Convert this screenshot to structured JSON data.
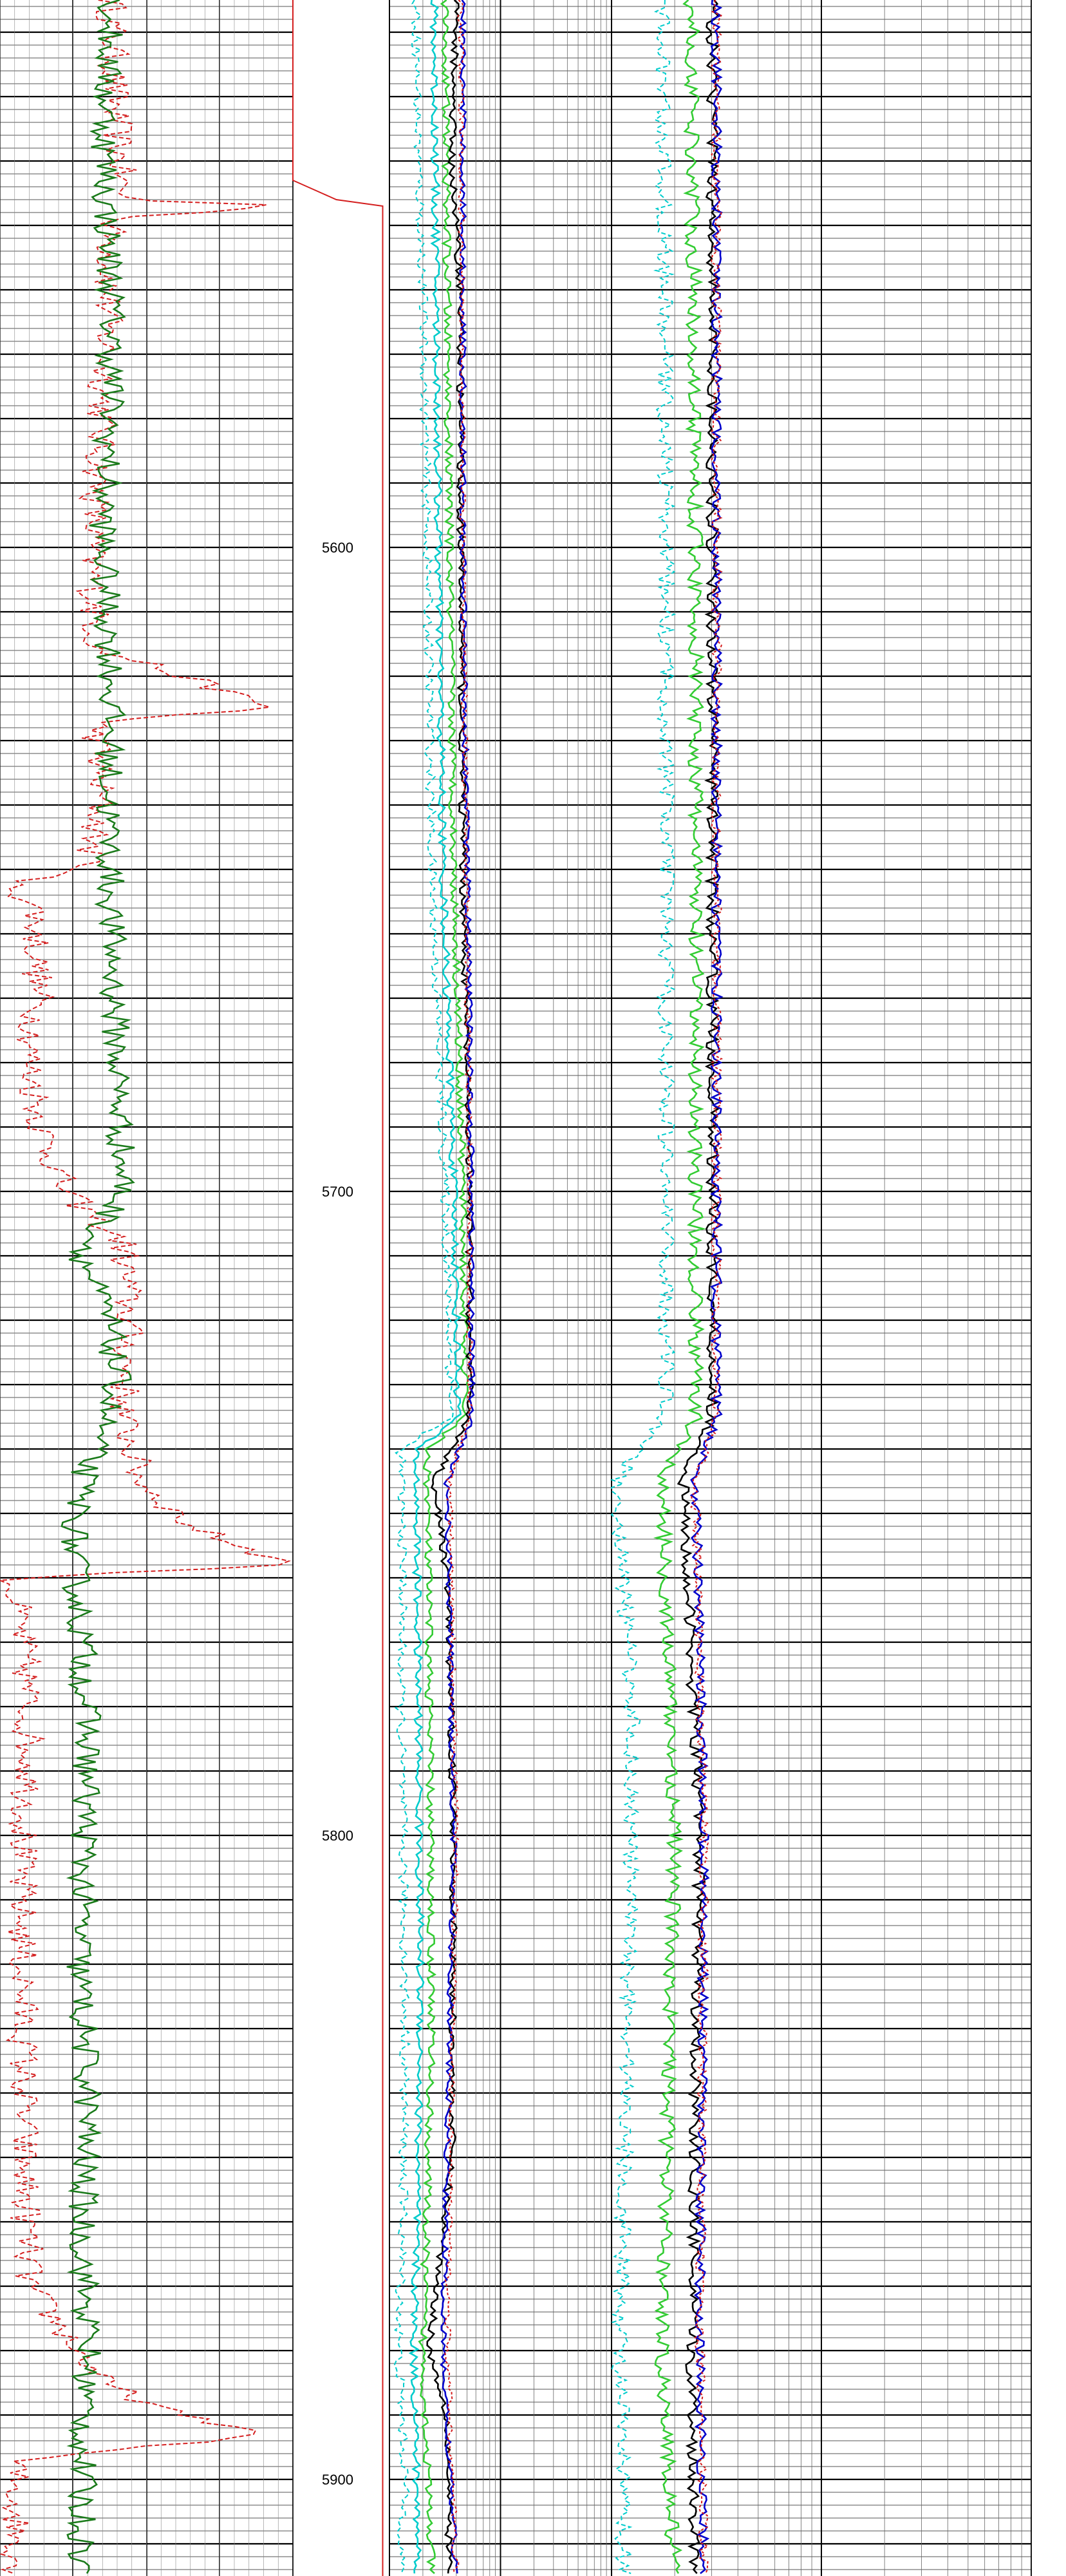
{
  "chart_data": {
    "type": "line",
    "title": "",
    "xlabel": "",
    "ylabel": "",
    "ylim": [
      5515,
      5915
    ],
    "depth_ticks": [
      5600,
      5700,
      5800,
      5900
    ],
    "depth_tick_labels": [
      "5600",
      "5700",
      "5800",
      "5900"
    ],
    "grid": true,
    "tracks": [
      {
        "id": "track1",
        "scale": "linear",
        "series": [
          {
            "color": "#d41e1e",
            "dash": "7,4",
            "noise": 0.055,
            "points": [
              [
                5515,
                0.38
              ],
              [
                5530,
                0.39
              ],
              [
                5546,
                0.42
              ],
              [
                5547,
                1.0
              ],
              [
                5549,
                0.38
              ],
              [
                5570,
                0.36
              ],
              [
                5585,
                0.34
              ],
              [
                5600,
                0.31
              ],
              [
                5616,
                0.33
              ],
              [
                5618,
                0.5
              ],
              [
                5625,
                0.93
              ],
              [
                5627,
                0.33
              ],
              [
                5640,
                0.34
              ],
              [
                5650,
                0.3
              ],
              [
                5652,
                0.03
              ],
              [
                5656,
                0.12
              ],
              [
                5670,
                0.13
              ],
              [
                5680,
                0.1
              ],
              [
                5690,
                0.14
              ],
              [
                5700,
                0.22
              ],
              [
                5708,
                0.42
              ],
              [
                5720,
                0.44
              ],
              [
                5735,
                0.42
              ],
              [
                5745,
                0.48
              ],
              [
                5752,
                0.65
              ],
              [
                5755,
                0.82
              ],
              [
                5758,
                0.99
              ],
              [
                5760,
                0.04
              ],
              [
                5775,
                0.09
              ],
              [
                5790,
                0.1
              ],
              [
                5805,
                0.07
              ],
              [
                5830,
                0.08
              ],
              [
                5850,
                0.08
              ],
              [
                5870,
                0.1
              ],
              [
                5885,
                0.35
              ],
              [
                5890,
                0.6
              ],
              [
                5893,
                0.92
              ],
              [
                5897,
                0.05
              ],
              [
                5915,
                0.06
              ]
            ]
          },
          {
            "color": "#1a7a1a",
            "dash": "",
            "noise": 0.05,
            "points": [
              [
                5515,
                0.38
              ],
              [
                5530,
                0.36
              ],
              [
                5545,
                0.36
              ],
              [
                5560,
                0.38
              ],
              [
                5575,
                0.38
              ],
              [
                5600,
                0.35
              ],
              [
                5620,
                0.38
              ],
              [
                5640,
                0.37
              ],
              [
                5660,
                0.38
              ],
              [
                5680,
                0.4
              ],
              [
                5700,
                0.42
              ],
              [
                5710,
                0.28
              ],
              [
                5720,
                0.37
              ],
              [
                5730,
                0.4
              ],
              [
                5745,
                0.28
              ],
              [
                5755,
                0.25
              ],
              [
                5770,
                0.28
              ],
              [
                5785,
                0.3
              ],
              [
                5800,
                0.29
              ],
              [
                5820,
                0.27
              ],
              [
                5840,
                0.3
              ],
              [
                5860,
                0.28
              ],
              [
                5880,
                0.3
              ],
              [
                5895,
                0.28
              ],
              [
                5915,
                0.28
              ]
            ]
          }
        ]
      },
      {
        "id": "track3",
        "scale": "log",
        "series": [
          {
            "color": "#00cccc",
            "dash": "7,4",
            "noise": 0.022,
            "points": [
              [
                5515,
                0.12
              ],
              [
                5540,
                0.13
              ],
              [
                5560,
                0.15
              ],
              [
                5600,
                0.17
              ],
              [
                5650,
                0.19
              ],
              [
                5700,
                0.25
              ],
              [
                5735,
                0.28
              ],
              [
                5740,
                0.05
              ],
              [
                5760,
                0.06
              ],
              [
                5780,
                0.05
              ],
              [
                5800,
                0.06
              ],
              [
                5830,
                0.07
              ],
              [
                5860,
                0.06
              ],
              [
                5880,
                0.04
              ],
              [
                5900,
                0.07
              ],
              [
                5915,
                0.05
              ]
            ]
          },
          {
            "color": "#00cccc",
            "dash": "",
            "noise": 0.018,
            "points": [
              [
                5515,
                0.2
              ],
              [
                5560,
                0.21
              ],
              [
                5600,
                0.22
              ],
              [
                5650,
                0.24
              ],
              [
                5700,
                0.29
              ],
              [
                5735,
                0.31
              ],
              [
                5740,
                0.12
              ],
              [
                5780,
                0.13
              ],
              [
                5830,
                0.14
              ],
              [
                5880,
                0.11
              ],
              [
                5915,
                0.13
              ]
            ]
          },
          {
            "color": "#33cc33",
            "dash": "",
            "noise": 0.018,
            "points": [
              [
                5515,
                0.25
              ],
              [
                5560,
                0.26
              ],
              [
                5600,
                0.27
              ],
              [
                5650,
                0.29
              ],
              [
                5700,
                0.33
              ],
              [
                5735,
                0.34
              ],
              [
                5740,
                0.17
              ],
              [
                5780,
                0.18
              ],
              [
                5830,
                0.19
              ],
              [
                5880,
                0.15
              ],
              [
                5915,
                0.19
              ]
            ]
          },
          {
            "color": "#000000",
            "dash": "",
            "noise": 0.016,
            "points": [
              [
                5515,
                0.3
              ],
              [
                5540,
                0.28
              ],
              [
                5560,
                0.32
              ],
              [
                5600,
                0.32
              ],
              [
                5650,
                0.33
              ],
              [
                5700,
                0.36
              ],
              [
                5735,
                0.36
              ],
              [
                5745,
                0.2
              ],
              [
                5760,
                0.26
              ],
              [
                5800,
                0.29
              ],
              [
                5850,
                0.28
              ],
              [
                5880,
                0.18
              ],
              [
                5890,
                0.26
              ],
              [
                5915,
                0.27
              ]
            ]
          },
          {
            "color": "#0000cc",
            "dash": "",
            "noise": 0.014,
            "points": [
              [
                5515,
                0.33
              ],
              [
                5600,
                0.33
              ],
              [
                5700,
                0.37
              ],
              [
                5735,
                0.37
              ],
              [
                5745,
                0.26
              ],
              [
                5800,
                0.29
              ],
              [
                5880,
                0.24
              ],
              [
                5915,
                0.3
              ]
            ]
          },
          {
            "color": "#d41e1e",
            "dash": "4,3",
            "noise": 0.014,
            "points": [
              [
                5515,
                0.32
              ],
              [
                5600,
                0.33
              ],
              [
                5700,
                0.36
              ],
              [
                5735,
                0.36
              ],
              [
                5745,
                0.27
              ],
              [
                5800,
                0.3
              ],
              [
                5880,
                0.26
              ],
              [
                5915,
                0.3
              ]
            ]
          }
        ]
      },
      {
        "id": "track4",
        "scale": "log",
        "series": [
          {
            "color": "#00cccc",
            "dash": "7,4",
            "noise": 0.02,
            "points": [
              [
                5515,
                0.12
              ],
              [
                5600,
                0.13
              ],
              [
                5700,
                0.13
              ],
              [
                5735,
                0.13
              ],
              [
                5745,
                0.01
              ],
              [
                5780,
                0.05
              ],
              [
                5830,
                0.04
              ],
              [
                5880,
                0.02
              ],
              [
                5915,
                0.03
              ]
            ]
          },
          {
            "color": "#33cc33",
            "dash": "",
            "noise": 0.018,
            "points": [
              [
                5515,
                0.19
              ],
              [
                5600,
                0.2
              ],
              [
                5700,
                0.2
              ],
              [
                5735,
                0.2
              ],
              [
                5745,
                0.12
              ],
              [
                5800,
                0.15
              ],
              [
                5880,
                0.12
              ],
              [
                5915,
                0.15
              ]
            ]
          },
          {
            "color": "#000000",
            "dash": "",
            "noise": 0.014,
            "points": [
              [
                5515,
                0.24
              ],
              [
                5600,
                0.24
              ],
              [
                5700,
                0.24
              ],
              [
                5735,
                0.24
              ],
              [
                5745,
                0.17
              ],
              [
                5800,
                0.21
              ],
              [
                5880,
                0.19
              ],
              [
                5915,
                0.2
              ]
            ]
          },
          {
            "color": "#0000cc",
            "dash": "",
            "noise": 0.012,
            "points": [
              [
                5515,
                0.25
              ],
              [
                5600,
                0.25
              ],
              [
                5700,
                0.25
              ],
              [
                5735,
                0.25
              ],
              [
                5745,
                0.2
              ],
              [
                5800,
                0.22
              ],
              [
                5880,
                0.21
              ],
              [
                5915,
                0.22
              ]
            ]
          },
          {
            "color": "#d41e1e",
            "dash": "4,3",
            "noise": 0.012,
            "points": [
              [
                5515,
                0.25
              ],
              [
                5600,
                0.25
              ],
              [
                5700,
                0.25
              ],
              [
                5735,
                0.25
              ],
              [
                5745,
                0.2
              ],
              [
                5800,
                0.22
              ],
              [
                5880,
                0.21
              ],
              [
                5915,
                0.22
              ]
            ]
          }
        ]
      }
    ],
    "depth_track_curve": {
      "color": "#d41e1e",
      "points": [
        [
          5515,
          0.0
        ],
        [
          5543,
          0.0
        ],
        [
          5546,
          0.45
        ],
        [
          5547,
          0.93
        ],
        [
          5915,
          0.93
        ]
      ]
    }
  }
}
